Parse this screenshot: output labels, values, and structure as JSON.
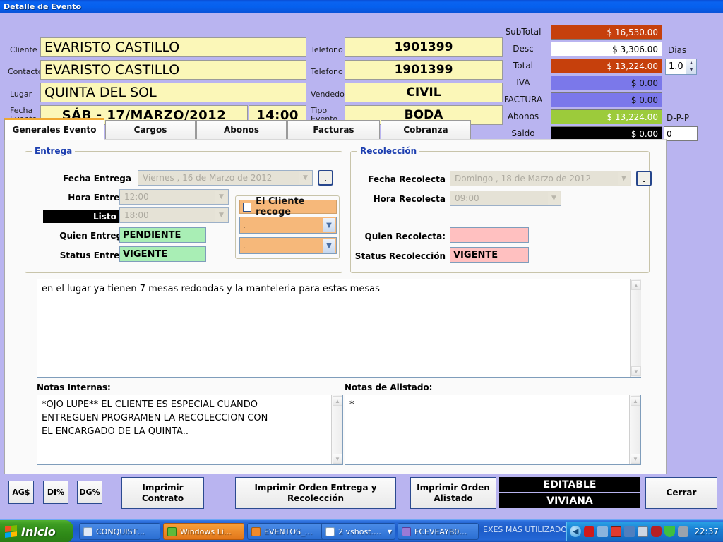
{
  "window": {
    "title": "Detalle de Evento"
  },
  "header": {
    "labels": {
      "cliente": "Cliente",
      "contacto": "Contacto",
      "lugar": "Lugar",
      "fecha_evento": "Fecha\nEvento",
      "telefono1": "Telefono",
      "telefono2": "Telefono",
      "vendedor": "Vendedor",
      "tipo_evento": "Tipo\nEvento"
    },
    "values": {
      "cliente": "EVARISTO CASTILLO",
      "contacto": "EVARISTO CASTILLO",
      "lugar": "QUINTA DEL SOL",
      "fecha_evento": "SÁB  -  17/MARZO/2012",
      "hora_evento": "14:00",
      "telefono1": "1901399",
      "telefono2": "1901399",
      "vendedor": "CIVIL",
      "tipo_evento": "BODA"
    }
  },
  "totals": {
    "rows": [
      {
        "label": "SubTotal",
        "value": "$ 16,530.00",
        "style": "orange"
      },
      {
        "label": "Desc",
        "value": "$ 3,306.00",
        "style": "white"
      },
      {
        "label": "Total",
        "value": "$ 13,224.00",
        "style": "orange"
      },
      {
        "label": "IVA",
        "value": "$ 0.00",
        "style": "blue"
      },
      {
        "label": "FACTURA",
        "value": "$ 0.00",
        "style": "blue"
      },
      {
        "label": "Abonos",
        "value": "$ 13,224.00",
        "style": "green"
      },
      {
        "label": "Saldo",
        "value": "$ 0.00",
        "style": "black"
      }
    ],
    "dias_label": "Dias",
    "dias_value": "1.0",
    "dpp_label": "D-P-P",
    "dpp_value": "0"
  },
  "tabs": [
    {
      "label": "Generales Evento",
      "active": true
    },
    {
      "label": "Cargos",
      "active": false
    },
    {
      "label": "Abonos",
      "active": false
    },
    {
      "label": "Facturas",
      "active": false
    },
    {
      "label": "Cobranza",
      "active": false
    }
  ],
  "entrega": {
    "title": "Entrega",
    "fecha_label": "Fecha Entrega",
    "fecha_value": "Viernes , 16 de    Marzo     de 2012",
    "hora_label": "Hora Entrega",
    "hora_value": "12:00",
    "listo_label": "Listo a:",
    "listo_value": "18:00",
    "quien_label": "Quien Entrega:",
    "quien_value": "PENDIENTE",
    "status_label": "Status Entrega",
    "status_value": "VIGENTE",
    "dot_button": ".",
    "recoge_label": "El Cliente recoge",
    "recoge_checked": false,
    "recoge_combo1": ".",
    "recoge_combo2": "."
  },
  "recoleccion": {
    "title": "Recolección",
    "fecha_label": "Fecha Recolecta",
    "fecha_value": "Domingo , 18 de    Marzo     de 2012",
    "hora_label": "Hora Recolecta",
    "hora_value": "09:00",
    "quien_label": "Quien Recolecta:",
    "quien_value": "",
    "status_label": "Status Recolección",
    "status_value": "VIGENTE",
    "dot_button": "."
  },
  "notes": {
    "general": "en el lugar ya tienen 7 mesas redondas y la manteleria para estas mesas",
    "internas_label": "Notas Internas:",
    "internas": "*OJO LUPE** EL CLIENTE ES ESPECIAL CUANDO\nENTREGUEN PROGRAMEN LA RECOLECCION CON\nEL ENCARGADO DE LA QUINTA..",
    "alistado_label": "Notas de Alistado:",
    "alistado": "*"
  },
  "footer": {
    "ags": "AG$",
    "dipct": "DI%",
    "dgpct": "DG%",
    "imprimir_contrato": "Imprimir\nContrato",
    "imprimir_orden_entrega": "Imprimir Orden Entrega y\nRecolección",
    "imprimir_orden_alistado": "Imprimir Orden\nAlistado",
    "estado": "EDITABLE",
    "usuario": "VIVIANA",
    "cerrar": "Cerrar"
  },
  "taskbar": {
    "start": "Inicio",
    "items": [
      {
        "label": "CONQUIST…",
        "icon": "document-icon",
        "color": "#dfe9f7",
        "hot": false
      },
      {
        "label": "Windows Li…",
        "icon": "messenger-icon",
        "color": "#5fba3a",
        "hot": true
      },
      {
        "label": "EVENTOS_…",
        "icon": "app-icon",
        "color": "#f08a2a",
        "hot": false
      },
      {
        "label": "2 vshost.…",
        "icon": "window-icon",
        "color": "#ffffff",
        "hot": false,
        "grouped": true
      },
      {
        "label": "FCEVEAYB0…",
        "icon": "vs-icon",
        "color": "#9a7ad6",
        "hot": false
      }
    ],
    "group_label": "EXES MAS UTILIZADOS",
    "tray_icons": [
      "show-hidden-icon",
      "acrobat-icon",
      "user-offline-icon",
      "recording-icon",
      "network-disconnected-icon",
      "display-icon",
      "mcafee-icon",
      "wireless-icon",
      "volume-icon"
    ],
    "clock": "22:37"
  }
}
